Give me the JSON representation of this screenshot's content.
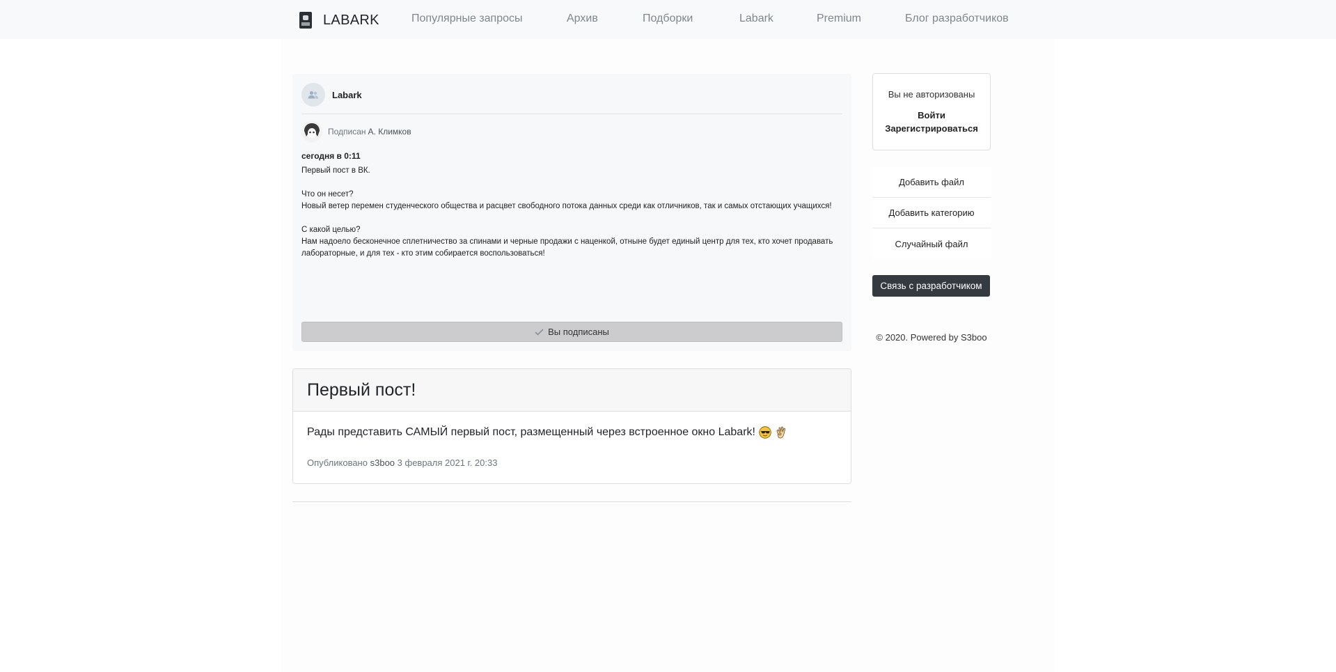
{
  "navbar": {
    "brand": "LABARK",
    "links": [
      "Популярные запросы",
      "Архив",
      "Подборки",
      "Labark",
      "Premium",
      "Блог разработчиков"
    ]
  },
  "group_post": {
    "group_name": "Labark",
    "signed_label": "Подписан",
    "signed_author": "А. Климков",
    "time": "сегодня в 0:11",
    "paragraphs": [
      "Первый пост в ВК.",
      "Что он несет?",
      "Новый ветер перемен студенческого общества и расцвет свободного потока данных среди как отличников, так и самых отстающих учащихся!",
      "С какой целью?",
      "Нам надоело бесконечное сплетничество за спинами и черные продажи с наценкой, отныне будет единый центр для тех, кто хочет продавать лабораторные, и для тех - кто этим собирается воспользоваться!"
    ],
    "subscribed_label": "Вы подписаны"
  },
  "post_card": {
    "title": "Первый пост!",
    "text": "Рады представить САМЫЙ первый пост, размещенный через встроенное окно Labark!",
    "emojis": [
      "sunglasses-emoji",
      "ok-hand-emoji"
    ],
    "meta_prefix": "Опубликовано",
    "meta_author": "s3boo",
    "meta_date": "3 февраля 2021 г. 20:33"
  },
  "sidebar": {
    "auth_status": "Вы не авторизованы",
    "login": "Войти",
    "register": "Зарегистрироваться",
    "actions": [
      "Добавить файл",
      "Добавить категорию",
      "Случайный файл"
    ],
    "dev_button": "Связь с разработчиком",
    "footer": "© 2020. Powered by S3boo"
  }
}
